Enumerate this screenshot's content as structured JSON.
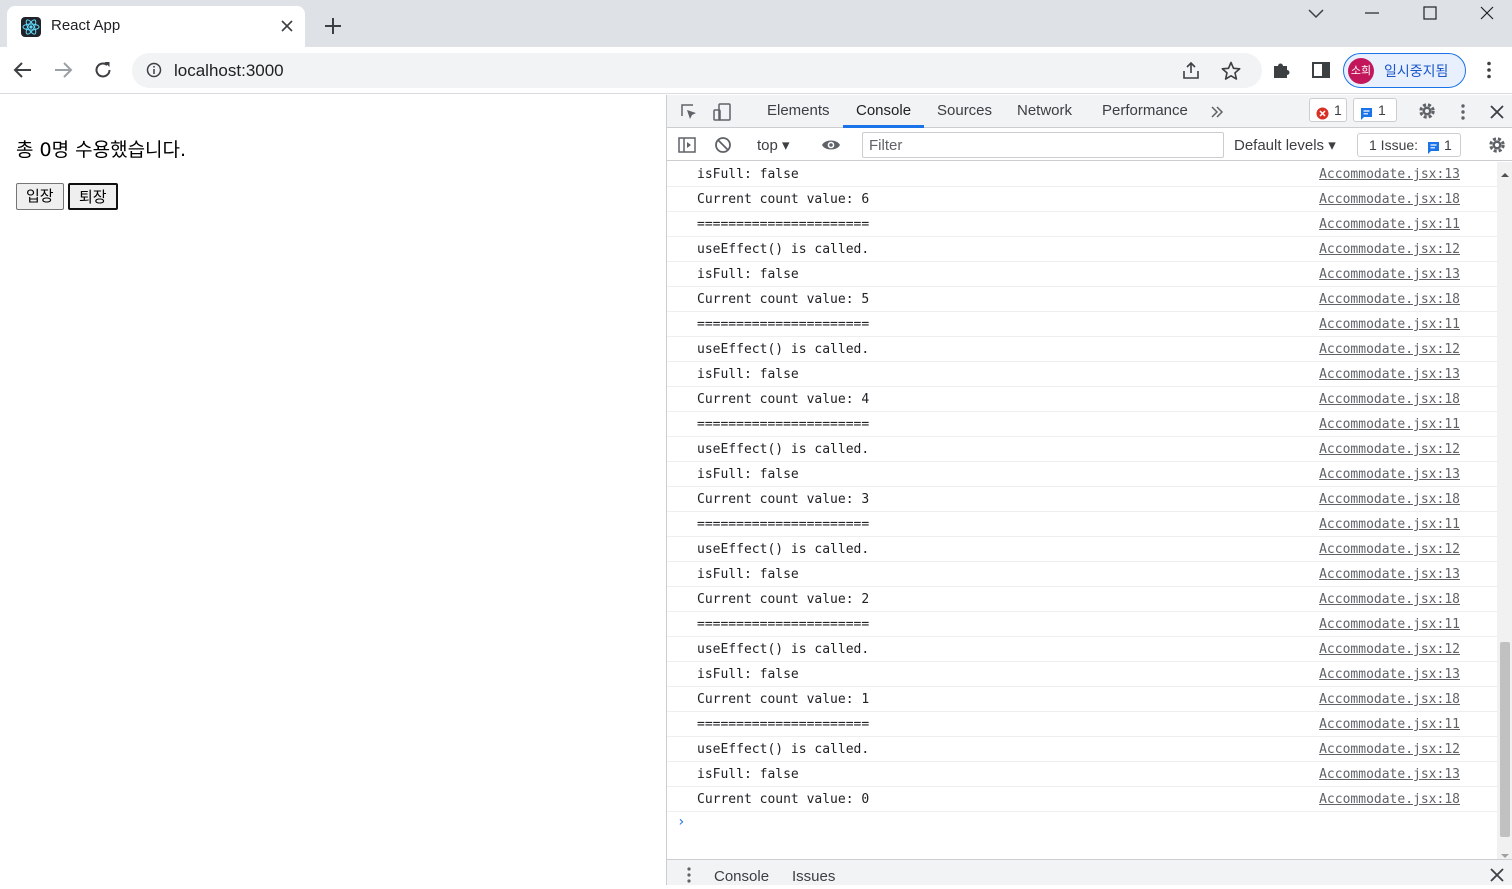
{
  "browser": {
    "tab_title": "React App",
    "url": "localhost:3000",
    "profile_label": "일시중지됨",
    "profile_initials": "소희"
  },
  "page": {
    "status_text": "총 0명 수용했습니다.",
    "enter_button": "입장",
    "leave_button": "퇴장"
  },
  "devtools": {
    "tabs": [
      "Elements",
      "Console",
      "Sources",
      "Network",
      "Performance"
    ],
    "active_tab": "Console",
    "error_count": "1",
    "message_count": "1",
    "context": "top",
    "filter_placeholder": "Filter",
    "levels": "Default levels",
    "issues_label": "1 Issue:",
    "issues_count": "1",
    "drawer_tabs": [
      "Console",
      "Issues"
    ],
    "prompt_symbol": "›",
    "console_log": [
      {
        "msg": "isFull: false",
        "src": "Accommodate.jsx:13"
      },
      {
        "msg": "Current count value: 6",
        "src": "Accommodate.jsx:18"
      },
      {
        "msg": "======================",
        "src": "Accommodate.jsx:11"
      },
      {
        "msg": "useEffect() is called.",
        "src": "Accommodate.jsx:12"
      },
      {
        "msg": "isFull: false",
        "src": "Accommodate.jsx:13"
      },
      {
        "msg": "Current count value: 5",
        "src": "Accommodate.jsx:18"
      },
      {
        "msg": "======================",
        "src": "Accommodate.jsx:11"
      },
      {
        "msg": "useEffect() is called.",
        "src": "Accommodate.jsx:12"
      },
      {
        "msg": "isFull: false",
        "src": "Accommodate.jsx:13"
      },
      {
        "msg": "Current count value: 4",
        "src": "Accommodate.jsx:18"
      },
      {
        "msg": "======================",
        "src": "Accommodate.jsx:11"
      },
      {
        "msg": "useEffect() is called.",
        "src": "Accommodate.jsx:12"
      },
      {
        "msg": "isFull: false",
        "src": "Accommodate.jsx:13"
      },
      {
        "msg": "Current count value: 3",
        "src": "Accommodate.jsx:18"
      },
      {
        "msg": "======================",
        "src": "Accommodate.jsx:11"
      },
      {
        "msg": "useEffect() is called.",
        "src": "Accommodate.jsx:12"
      },
      {
        "msg": "isFull: false",
        "src": "Accommodate.jsx:13"
      },
      {
        "msg": "Current count value: 2",
        "src": "Accommodate.jsx:18"
      },
      {
        "msg": "======================",
        "src": "Accommodate.jsx:11"
      },
      {
        "msg": "useEffect() is called.",
        "src": "Accommodate.jsx:12"
      },
      {
        "msg": "isFull: false",
        "src": "Accommodate.jsx:13"
      },
      {
        "msg": "Current count value: 1",
        "src": "Accommodate.jsx:18"
      },
      {
        "msg": "======================",
        "src": "Accommodate.jsx:11"
      },
      {
        "msg": "useEffect() is called.",
        "src": "Accommodate.jsx:12"
      },
      {
        "msg": "isFull: false",
        "src": "Accommodate.jsx:13"
      },
      {
        "msg": "Current count value: 0",
        "src": "Accommodate.jsx:18"
      }
    ]
  },
  "colors": {
    "accent": "#1a73e8",
    "error": "#d93025"
  }
}
